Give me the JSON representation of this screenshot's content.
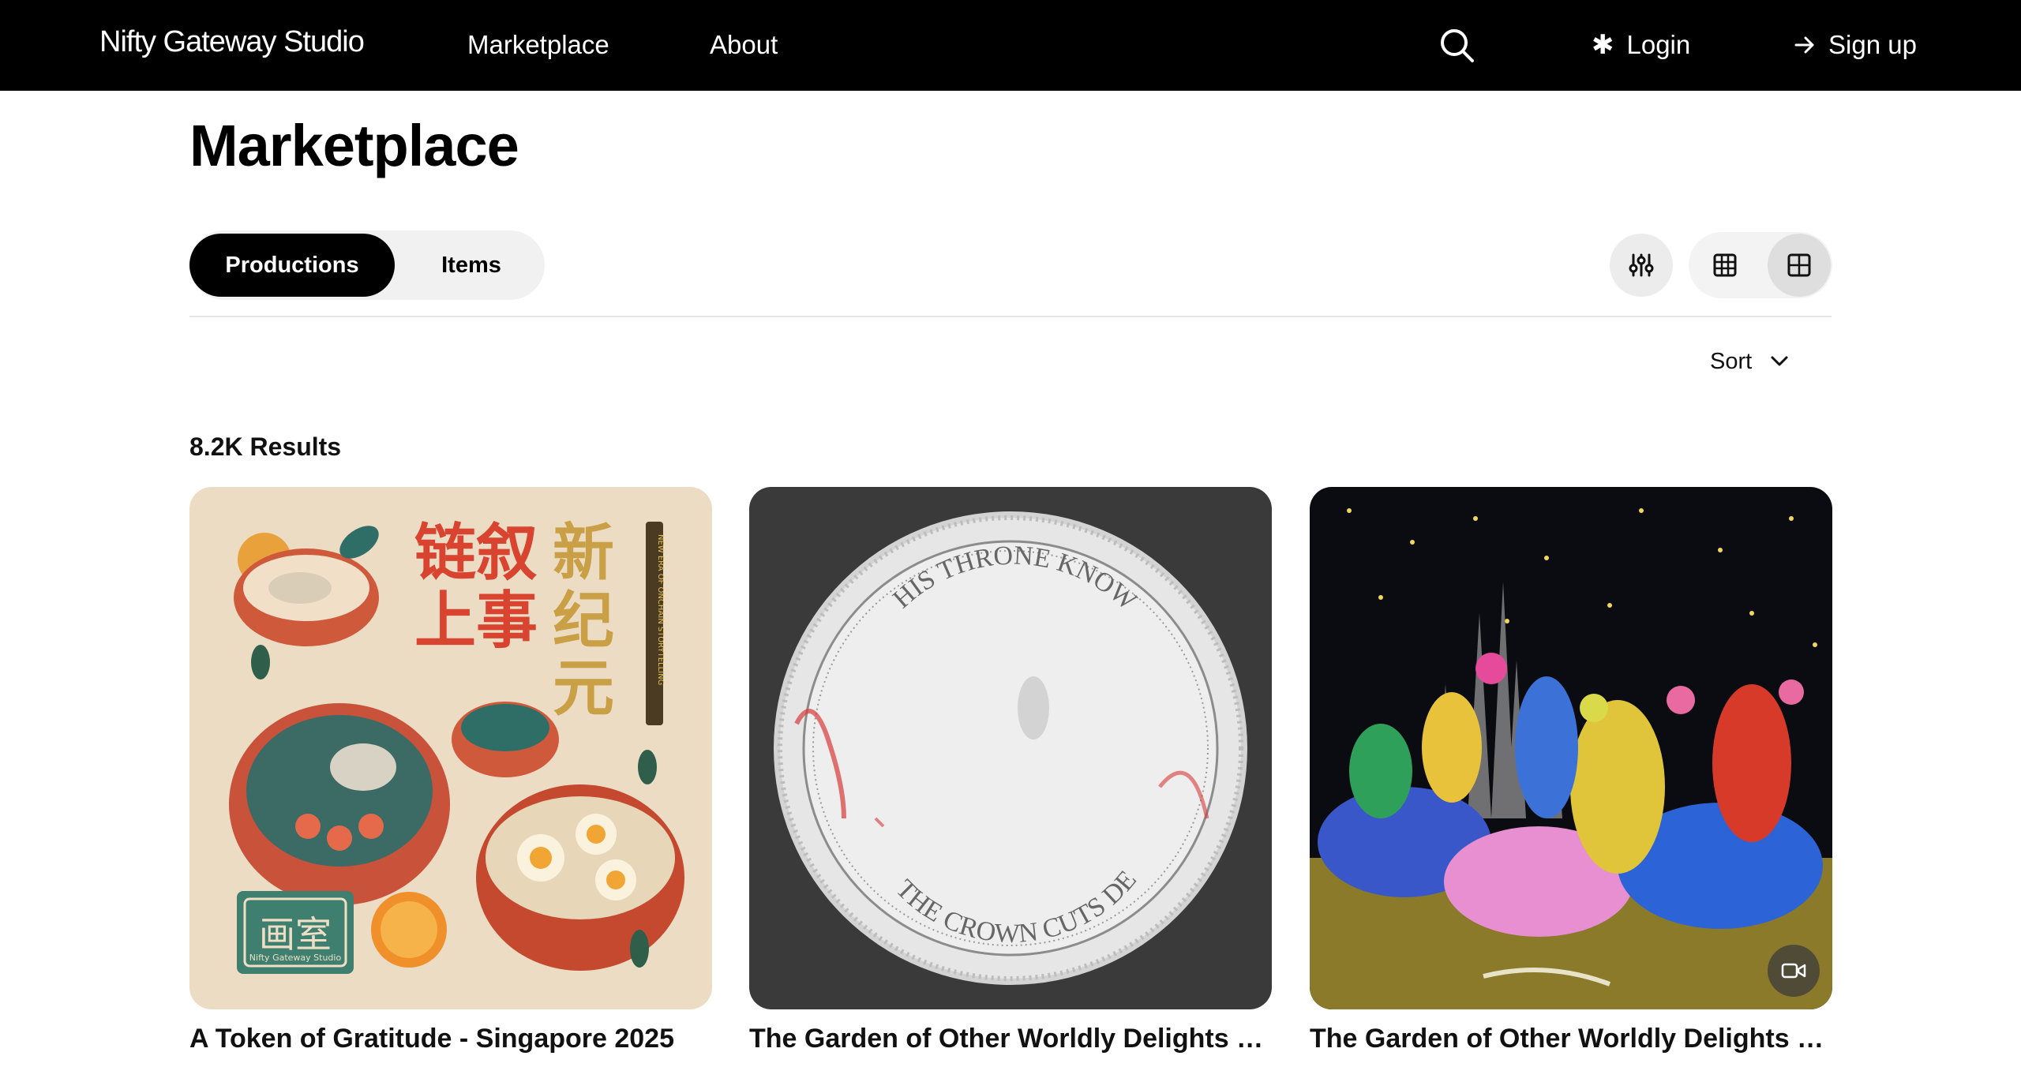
{
  "nav": {
    "brand": "Nifty Gateway Studio",
    "links": [
      "Marketplace",
      "About"
    ],
    "login_label": "Login",
    "signup_label": "Sign up",
    "icons": [
      "search-icon",
      "asterisk-icon",
      "arrow-right-icon"
    ]
  },
  "page": {
    "title": "Marketplace",
    "tabs": [
      {
        "label": "Productions",
        "active": true
      },
      {
        "label": "Items",
        "active": false
      }
    ],
    "view_modes": [
      "grid-small-icon",
      "grid-large-icon"
    ],
    "active_view": "grid-large",
    "sort_label": "Sort",
    "results_label": "8.2K Results"
  },
  "cards": [
    {
      "title": "A Token of Gratitude - Singapore 2025",
      "image": "illustration of noodle bowls with Chinese text",
      "image_text": [
        "链叙新",
        "上事纪",
        "元",
        "画室",
        "Nifty Gateway Studio",
        "NEW ERA OF ONCHAIN STORYTELLING"
      ],
      "has_video": false
    },
    {
      "title": "The Garden of Other Worldly Delights - Si...",
      "image": "worn coin",
      "image_text": [
        "HIS THRONE KNOWS ALL",
        "THE CROWN CUTS DEEP"
      ],
      "has_video": false
    },
    {
      "title": "The Garden of Other Worldly Delights - Si...",
      "image": "colorful procession of masked riders under starry sky",
      "has_video": true
    }
  ],
  "colors": {
    "nav_bg": "#000000",
    "active_tab": "#000000",
    "toggle_bg": "#f1f1f1"
  }
}
